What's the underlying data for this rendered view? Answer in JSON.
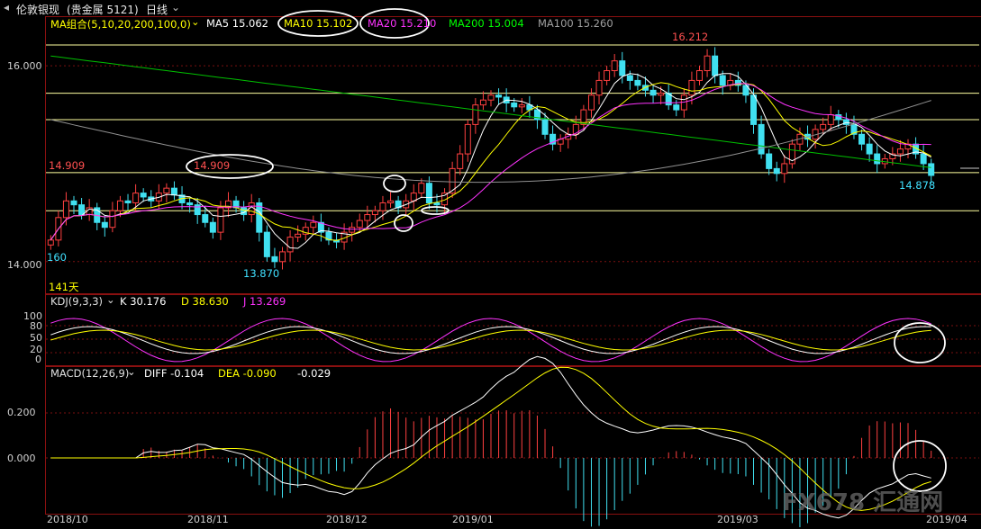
{
  "title_bar": {
    "icon": "chevron-left-icon",
    "name": "伦敦银现",
    "market": "(贵金属 5121)",
    "period": "日线",
    "period_icon": "chevron-down-icon"
  },
  "main_legend": {
    "ma_label": "MA组合(5,10,20,200,100,0)",
    "ma5": "MA5 15.062",
    "ma10": "MA10 15.102",
    "ma20": "MA20 15.210",
    "ma200": "MA200 15.004",
    "ma100": "MA100 15.260",
    "colors": {
      "ma5": "#ffffff",
      "ma10": "#ffff00",
      "ma20": "#ff00ff",
      "ma200": "#00ff00",
      "ma100": "#a0a0a0"
    }
  },
  "main_annotations": {
    "high_label": "16.212",
    "left_level": "14.909",
    "mid_level": "14.909",
    "right_level": "14.878",
    "low_label": "13.870",
    "left_160": "160",
    "days": "141天"
  },
  "main_axis": {
    "ticks": [
      "16.000",
      "14.000"
    ]
  },
  "kdj": {
    "label": "KDJ(9,3,3)",
    "k": "K 30.176",
    "d": "D 38.630",
    "j": "J 13.269",
    "ticks": [
      "100",
      "80",
      "50",
      "20",
      "0"
    ]
  },
  "macd": {
    "label": "MACD(12,26,9)",
    "diff": "DIFF -0.104",
    "dea": "DEA -0.090",
    "macd_val": "-0.029",
    "ticks": [
      "0.200",
      "0.000"
    ]
  },
  "dates": [
    "2018/10",
    "2018/11",
    "2018/12",
    "2019/01",
    "2019/03",
    "2019/04"
  ],
  "watermark": "FX678 汇通网",
  "chart_data": [
    {
      "type": "candlestick",
      "title": "伦敦银现 日线",
      "y_ticks": [
        14.0,
        16.0
      ],
      "ylim": [
        13.75,
        16.35
      ],
      "x_ticks": [
        "2018/10",
        "2018/11",
        "2018/12",
        "2019/01",
        "2019/03",
        "2019/04"
      ],
      "horizontal_levels": [
        16.212,
        15.72,
        15.45,
        14.909,
        14.52
      ],
      "annotations": [
        {
          "text": "16.212",
          "kind": "high"
        },
        {
          "text": "13.870",
          "kind": "low"
        },
        {
          "text": "14.909",
          "kind": "level"
        },
        {
          "text": "14.878",
          "kind": "last"
        }
      ],
      "series": [
        {
          "name": "MA5",
          "last": 15.062
        },
        {
          "name": "MA10",
          "last": 15.102
        },
        {
          "name": "MA20",
          "last": 15.21
        },
        {
          "name": "MA200",
          "last": 15.004
        },
        {
          "name": "MA100",
          "last": 15.26
        }
      ],
      "closes": [
        14.22,
        14.45,
        14.62,
        14.58,
        14.48,
        14.55,
        14.4,
        14.35,
        14.52,
        14.62,
        14.6,
        14.7,
        14.66,
        14.62,
        14.7,
        14.75,
        14.68,
        14.6,
        14.58,
        14.48,
        14.4,
        14.3,
        14.55,
        14.62,
        14.55,
        14.48,
        14.6,
        14.3,
        14.05,
        14.0,
        14.1,
        14.25,
        14.28,
        14.35,
        14.4,
        14.3,
        14.22,
        14.2,
        14.3,
        14.35,
        14.42,
        14.48,
        14.52,
        14.6,
        14.62,
        14.55,
        14.62,
        14.7,
        14.8,
        14.6,
        14.58,
        14.7,
        14.95,
        15.1,
        15.4,
        15.6,
        15.65,
        15.7,
        15.68,
        15.62,
        15.58,
        15.6,
        15.55,
        15.45,
        15.3,
        15.2,
        15.25,
        15.3,
        15.4,
        15.55,
        15.7,
        15.85,
        15.95,
        16.05,
        15.9,
        15.85,
        15.8,
        15.75,
        15.7,
        15.72,
        15.6,
        15.55,
        15.7,
        15.85,
        15.95,
        16.1,
        15.9,
        15.8,
        15.85,
        15.8,
        15.7,
        15.4,
        15.1,
        14.95,
        14.9,
        15.0,
        15.2,
        15.3,
        15.25,
        15.35,
        15.4,
        15.5,
        15.45,
        15.4,
        15.3,
        15.2,
        15.1,
        15.0,
        15.05,
        15.1,
        15.15,
        15.2,
        15.1,
        15.0,
        14.88
      ]
    },
    {
      "type": "line",
      "title": "KDJ(9,3,3)",
      "y_ticks": [
        0,
        20,
        50,
        80,
        100
      ],
      "series": [
        {
          "name": "K",
          "last": 30.176
        },
        {
          "name": "D",
          "last": 38.63
        },
        {
          "name": "J",
          "last": 13.269
        }
      ]
    },
    {
      "type": "bar",
      "title": "MACD(12,26,9)",
      "y_ticks": [
        0.0,
        0.2
      ],
      "series": [
        {
          "name": "DIFF",
          "last": -0.104
        },
        {
          "name": "DEA",
          "last": -0.09
        },
        {
          "name": "MACD",
          "last": -0.029
        }
      ]
    }
  ]
}
